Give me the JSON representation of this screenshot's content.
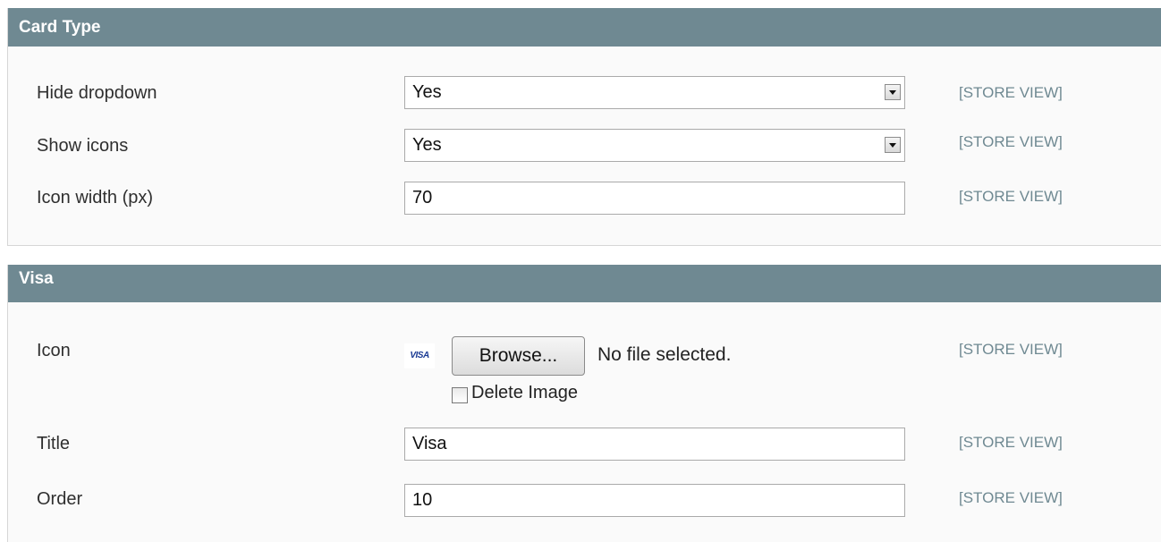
{
  "card_type": {
    "title": "Card Type",
    "fields": {
      "hide_dropdown": {
        "label": "Hide dropdown",
        "value": "Yes",
        "scope": "[STORE VIEW]"
      },
      "show_icons": {
        "label": "Show icons",
        "value": "Yes",
        "scope": "[STORE VIEW]"
      },
      "icon_width": {
        "label": "Icon width (px)",
        "value": "70",
        "scope": "[STORE VIEW]"
      }
    }
  },
  "visa": {
    "title": "Visa",
    "fields": {
      "icon": {
        "label": "Icon",
        "thumb_text": "VISA",
        "browse_label": "Browse...",
        "file_status": "No file selected.",
        "delete_label": "Delete Image",
        "delete_checked": false,
        "scope": "[STORE VIEW]"
      },
      "title": {
        "label": "Title",
        "value": "Visa",
        "scope": "[STORE VIEW]"
      },
      "order": {
        "label": "Order",
        "value": "10",
        "scope": "[STORE VIEW]"
      }
    }
  },
  "colors": {
    "header_bg": "#6f8992",
    "scope_text": "#6f8992"
  }
}
